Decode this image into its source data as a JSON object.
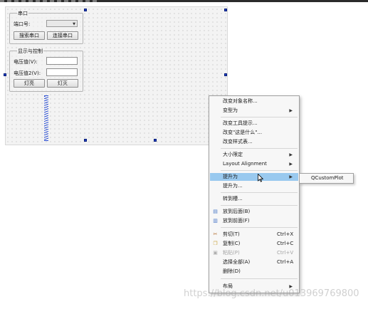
{
  "groups": {
    "serial": {
      "title": "串口",
      "port_label": "端口号:",
      "combo_value": "",
      "buttons": [
        "搜索串口",
        "连接串口"
      ]
    },
    "display": {
      "title": "显示与控制",
      "labels": [
        "电压值(V):",
        "电压值2(V):"
      ],
      "buttons": [
        "灯亮",
        "灯灭"
      ]
    }
  },
  "menu": {
    "items": [
      {
        "label": "改变对象名称..."
      },
      {
        "label": "变型为",
        "submenu": true
      },
      {
        "label": "改变工具提示..."
      },
      {
        "label": "改变\"这是什么\"..."
      },
      {
        "label": "改变样式表..."
      },
      {
        "label": "大小限定",
        "submenu": true
      },
      {
        "label": "Layout Alignment",
        "submenu": true
      },
      {
        "label": "提升为",
        "submenu": true,
        "highlighted": true
      },
      {
        "label": "提升为..."
      },
      {
        "label": "转到槽..."
      },
      {
        "label": "放到后面(B)",
        "icon": "send-to-back-icon"
      },
      {
        "label": "放到前面(F)",
        "icon": "bring-to-front-icon"
      },
      {
        "label": "剪切(T)",
        "shortcut": "Ctrl+X",
        "icon": "cut-icon"
      },
      {
        "label": "复制(C)",
        "shortcut": "Ctrl+C",
        "icon": "copy-icon"
      },
      {
        "label": "粘贴(P)",
        "shortcut": "Ctrl+V",
        "icon": "paste-icon",
        "disabled": true
      },
      {
        "label": "选择全部(A)",
        "shortcut": "Ctrl+A"
      },
      {
        "label": "删除(D)"
      },
      {
        "label": "布局",
        "submenu": true
      }
    ],
    "submenu_item": "QCustomPlot"
  },
  "watermark": "https://blog.csdn.net/u013969769800",
  "colors": {
    "highlight": "#99c9ef",
    "handle": "#1f3fbf",
    "spacer": "#2b4fd6"
  }
}
